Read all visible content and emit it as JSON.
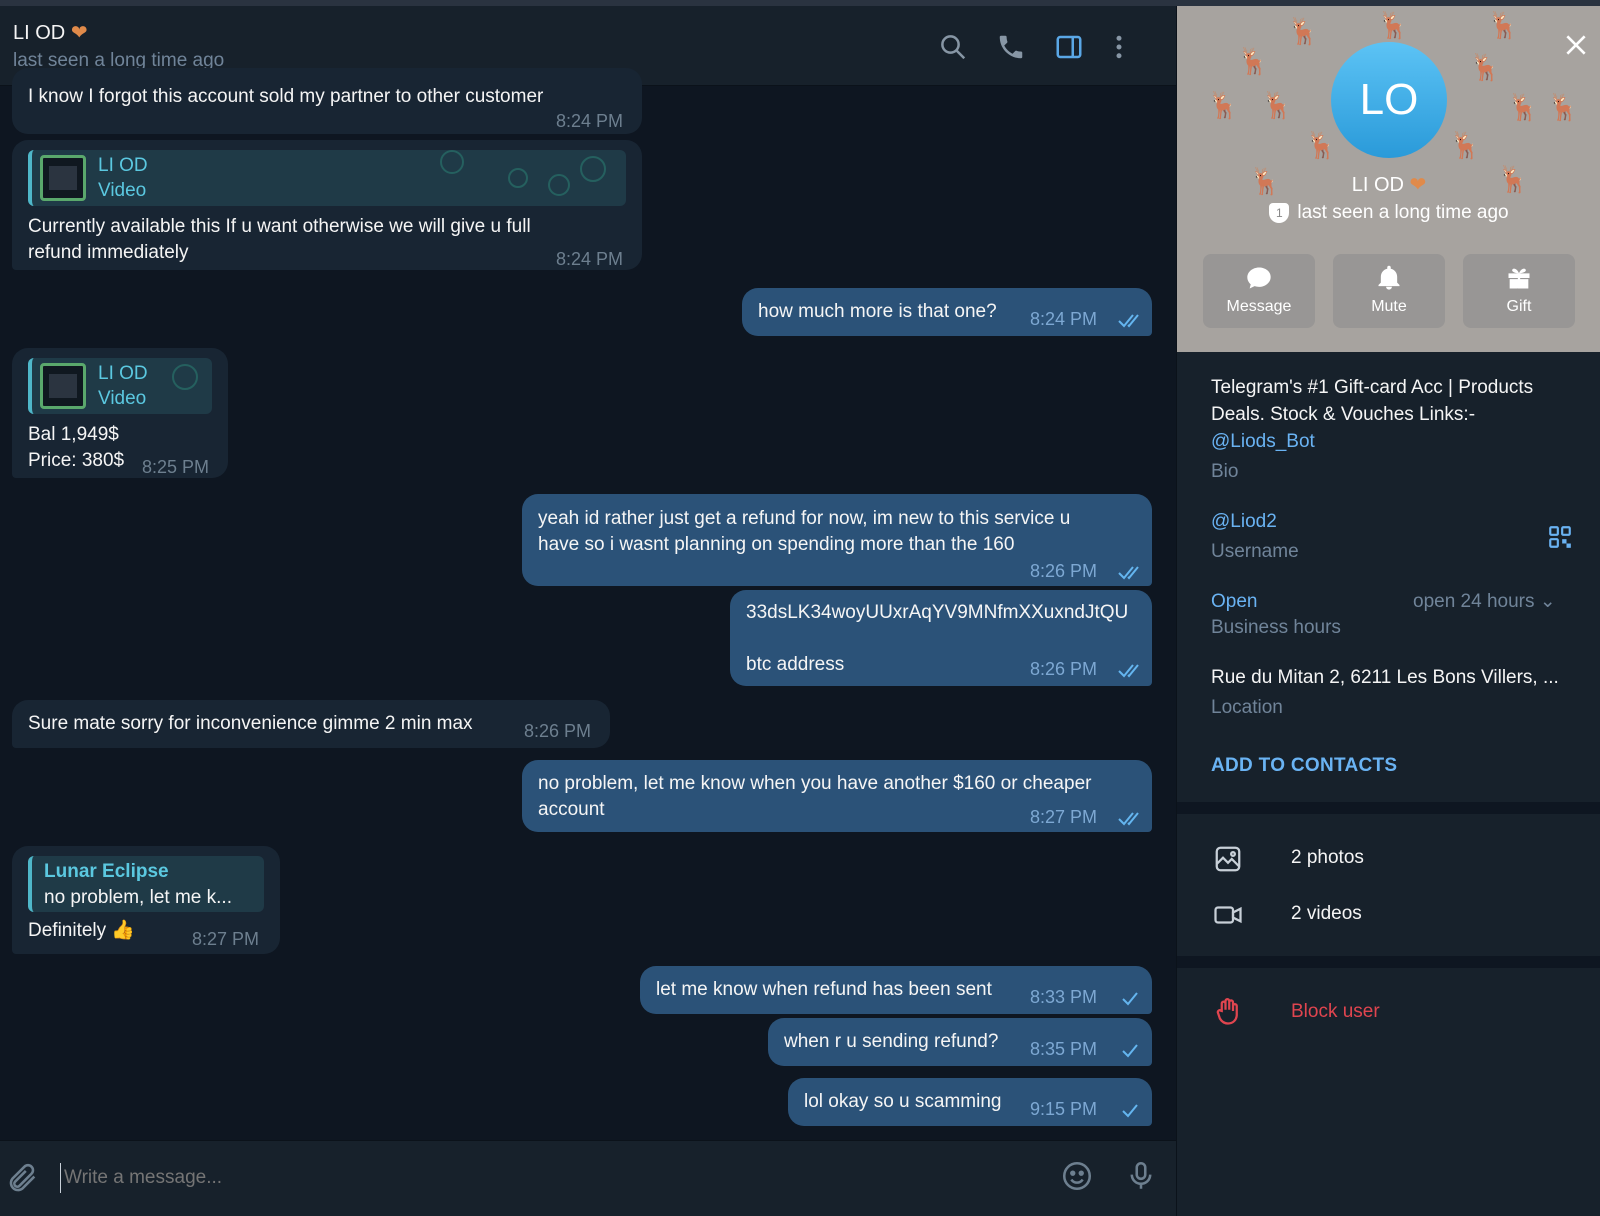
{
  "header": {
    "name": "LI OD",
    "status": "last seen a long time ago",
    "icons": [
      "search-icon",
      "phone-icon",
      "sidebar-toggle-icon",
      "more-icon"
    ]
  },
  "messages": [
    {
      "dir": "in",
      "text": "I know I forgot this account sold my partner to other customer",
      "time": "8:24 PM"
    },
    {
      "dir": "in",
      "media_name": "LI OD",
      "media_kind": "Video",
      "text": "Currently available this If u want otherwise we will give u full\nrefund immediately",
      "time": "8:24 PM"
    },
    {
      "dir": "out",
      "text": "how much more is that one?",
      "time": "8:24 PM",
      "read": true
    },
    {
      "dir": "in",
      "media_name": "LI OD",
      "media_kind": "Video",
      "text": "Bal 1,949$\nPrice: 380$",
      "time": "8:25 PM"
    },
    {
      "dir": "out",
      "text": "yeah id rather just get a refund for now, im new to this service u\nhave so i wasnt planning on spending more than the 160",
      "time": "8:26 PM",
      "read": true
    },
    {
      "dir": "out",
      "text": "33dsLK34woyUUxrAqYV9MNfmXXuxndJtQU\n\nbtc address",
      "time": "8:26 PM",
      "read": true
    },
    {
      "dir": "in",
      "text": "Sure mate sorry for inconvenience gimme 2 min max",
      "time": "8:26 PM"
    },
    {
      "dir": "out",
      "text": "no problem, let me know when you have another $160 or cheaper\naccount",
      "time": "8:27 PM",
      "read": true
    },
    {
      "dir": "in",
      "reply_name": "Lunar Eclipse",
      "reply_text": "no problem, let me k...",
      "text": "Definitely 👍",
      "time": "8:27 PM"
    },
    {
      "dir": "out",
      "text": "let me know when refund has been sent",
      "time": "8:33 PM",
      "read": false
    },
    {
      "dir": "out",
      "text": "when r u sending refund?",
      "time": "8:35 PM",
      "read": false
    },
    {
      "dir": "out",
      "text": "lol okay so u scamming",
      "time": "9:15 PM",
      "read": false
    }
  ],
  "composer": {
    "placeholder": "Write a message..."
  },
  "panel": {
    "avatar_initials": "LO",
    "name": "LI OD",
    "status": "last seen a long time ago",
    "actions": [
      {
        "label": "Message",
        "icon": "message-icon"
      },
      {
        "label": "Mute",
        "icon": "bell-icon"
      },
      {
        "label": "Gift",
        "icon": "gift-icon"
      }
    ],
    "bio_text": "Telegram's #1 Gift-card Acc | Products\nDeals. Stock & Vouches Links:-",
    "bio_link": "@Liods_Bot",
    "bio_label": "Bio",
    "username": "@Liod2",
    "username_label": "Username",
    "hours_status": "Open",
    "hours_value": "open 24 hours",
    "hours_label": "Business hours",
    "location": "Rue du Mitan 2, 6211 Les Bons Villers, ...",
    "location_label": "Location",
    "add_contacts": "ADD TO CONTACTS",
    "media": [
      {
        "label": "2 photos",
        "icon": "photo-icon"
      },
      {
        "label": "2 videos",
        "icon": "video-icon"
      }
    ],
    "block": "Block user"
  },
  "colors": {
    "background": "#0e1621",
    "incoming_bubble": "#182533",
    "outgoing_bubble": "#2b5278",
    "accent_link": "#6ab3f3",
    "danger": "#e0454f"
  }
}
